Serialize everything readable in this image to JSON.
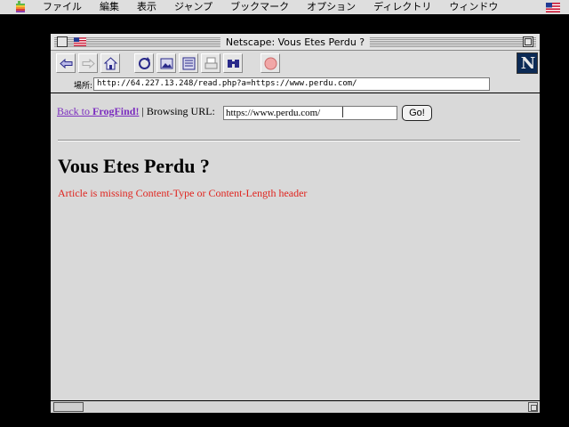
{
  "menubar": {
    "items": [
      "ファイル",
      "編集",
      "表示",
      "ジャンプ",
      "ブックマーク",
      "オプション",
      "ディレクトリ",
      "ウィンドウ"
    ],
    "apple_icon": "apple-icon",
    "flag_icon": "us-flag-icon"
  },
  "window": {
    "title": "Netscape: Vous Etes Perdu ?"
  },
  "toolbar": {
    "buttons": [
      "back-icon",
      "forward-icon",
      "home-icon",
      "reload-icon",
      "images-icon",
      "open-icon",
      "print-icon",
      "find-icon",
      "stop-icon"
    ],
    "logo": "N"
  },
  "location": {
    "label": "場所:",
    "url": "http://64.227.13.248/read.php?a=https://www.perdu.com/"
  },
  "page": {
    "back_link_prefix": "Back to ",
    "back_link_name": "FrogFind!",
    "separator": " | Browsing URL: ",
    "url_value": "https://www.perdu.com/",
    "go_label": "Go!",
    "heading": "Vous Etes Perdu ?",
    "error": "Article is missing Content-Type or Content-Length header"
  },
  "colors": {
    "link": "#7b2cbf",
    "error": "#e0241e",
    "window_bg": "#d9d9d9"
  }
}
